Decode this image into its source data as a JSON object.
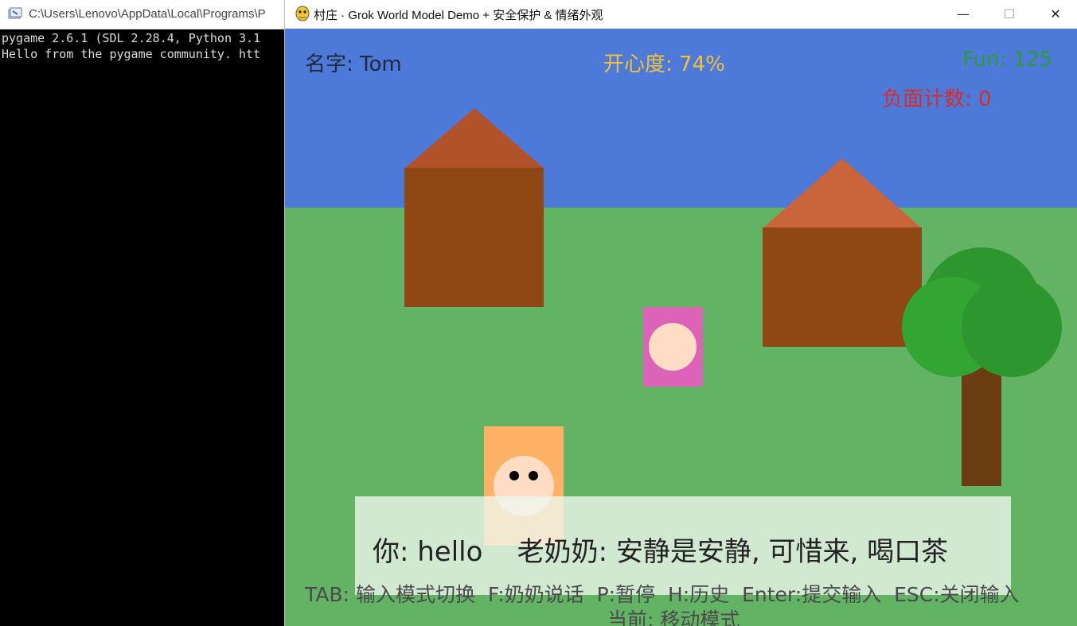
{
  "console": {
    "title": "C:\\Users\\Lenovo\\AppData\\Local\\Programs\\P",
    "lines": [
      "pygame 2.6.1 (SDL 2.28.4, Python 3.1",
      "Hello from the pygame community. htt"
    ]
  },
  "window": {
    "title": "村庄 · Grok World Model Demo + 安全保护 & 情绪外观",
    "minimize_glyph": "—",
    "maximize_glyph": "☐",
    "close_glyph": "✕"
  },
  "hud": {
    "name": "名字: Tom",
    "happiness": "开心度: 74%",
    "fun": "Fun: 125",
    "negative_count": "负面计数: 0"
  },
  "dialog": {
    "text": "你: hello    老奶奶: 安静是安静, 可惜来, 喝口茶"
  },
  "help": {
    "keys": "TAB: 输入模式切换  F:奶奶说话  P:暂停  H:历史  Enter:提交输入  ESC:关闭输入",
    "mode": "当前: 移动模式"
  },
  "colors": {
    "sky": "#4d79d9",
    "grass": "#63b365",
    "house_wall": "#8f4714",
    "roof_left": "#b2522a",
    "roof_right": "#c9643b",
    "npc_body": "#dd63b9",
    "player_body": "#ffb266",
    "face": "#ffdcc4",
    "tree_leaves": "#2e962e",
    "tree_trunk": "#6b3b12"
  }
}
